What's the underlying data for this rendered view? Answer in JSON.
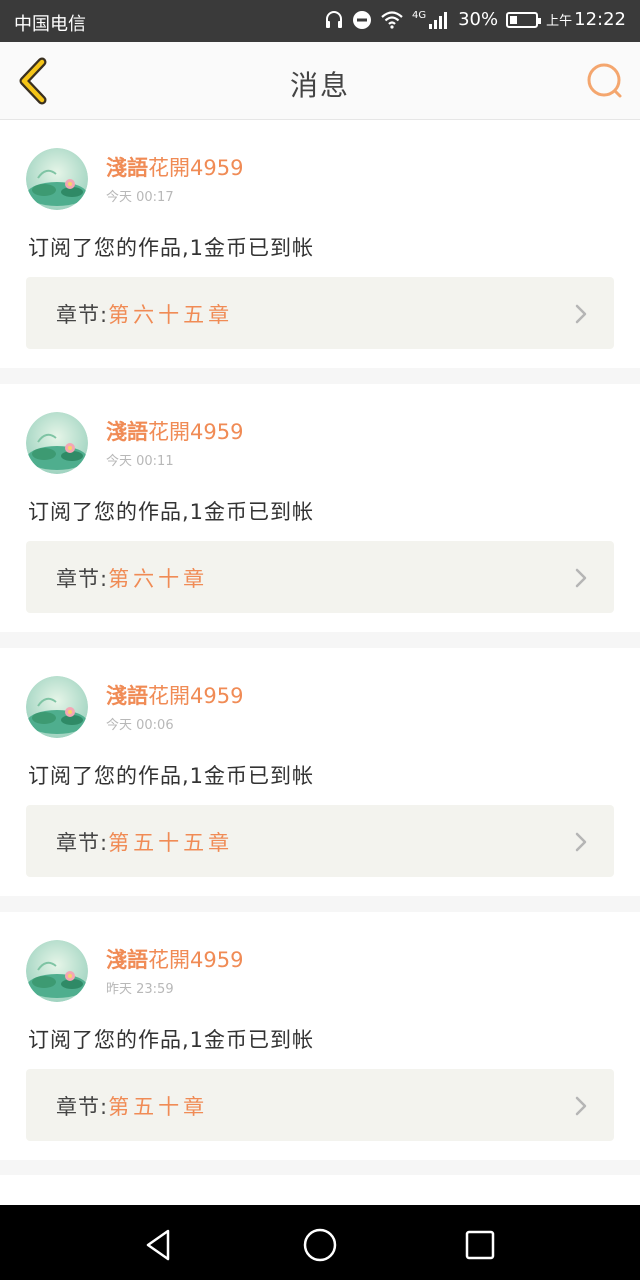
{
  "status_bar": {
    "carrier": "中国电信",
    "network": "4G",
    "battery": "30%",
    "battery_level": 0.3,
    "time_prefix": "上午",
    "time": "12:22"
  },
  "header": {
    "title": "消息",
    "back_icon": "back-arrow-icon",
    "search_icon": "search-icon"
  },
  "messages": [
    {
      "user_bold": "淺語",
      "user_rest": "花開4959",
      "time": "今天 00:17",
      "text": "订阅了您的作品,1金币已到帐",
      "chapter_label": "章节:",
      "chapter_title": "第六十五章"
    },
    {
      "user_bold": "淺語",
      "user_rest": "花開4959",
      "time": "今天 00:11",
      "text": "订阅了您的作品,1金币已到帐",
      "chapter_label": "章节:",
      "chapter_title": "第六十章"
    },
    {
      "user_bold": "淺語",
      "user_rest": "花開4959",
      "time": "今天 00:06",
      "text": "订阅了您的作品,1金币已到帐",
      "chapter_label": "章节:",
      "chapter_title": "第五十五章"
    },
    {
      "user_bold": "淺語",
      "user_rest": "花開4959",
      "time": "昨天 23:59",
      "text": "订阅了您的作品,1金币已到帐",
      "chapter_label": "章节:",
      "chapter_title": "第五十章"
    }
  ],
  "colors": {
    "accent": "#f08b55",
    "header_bg": "#fafafa",
    "chapter_box_bg": "#f3f3ee"
  }
}
